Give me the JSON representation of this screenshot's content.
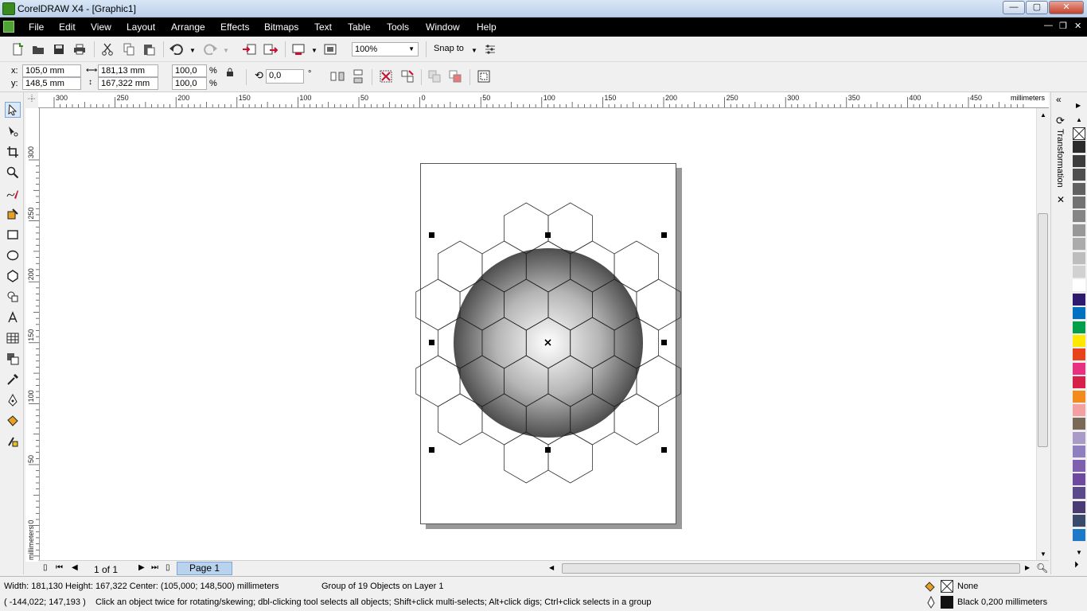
{
  "window": {
    "title": "CorelDRAW X4 - [Graphic1]",
    "controls": {
      "minimize": "—",
      "maximize": "▢",
      "close": "✕"
    }
  },
  "menu": {
    "items": [
      "File",
      "Edit",
      "View",
      "Layout",
      "Arrange",
      "Effects",
      "Bitmaps",
      "Text",
      "Table",
      "Tools",
      "Window",
      "Help"
    ],
    "doc_controls": {
      "minimize": "—",
      "restore": "❐",
      "close": "✕"
    }
  },
  "toolbar": {
    "zoom_value": "100%",
    "snap_to_label": "Snap to"
  },
  "property_bar": {
    "x_label": "x:",
    "x_value": "105,0 mm",
    "y_label": "y:",
    "y_value": "148,5 mm",
    "width_value": "181,13 mm",
    "height_value": "167,322 mm",
    "scale_x": "100,0",
    "scale_y": "100,0",
    "percent": "%",
    "rotation_value": "0,0",
    "degree": "°"
  },
  "ruler": {
    "h_labels": [
      "300",
      "250",
      "200",
      "150",
      "100",
      "50",
      "0",
      "50",
      "100",
      "150",
      "200",
      "250",
      "300",
      "350",
      "400",
      "450"
    ],
    "units": "millimeters",
    "v_labels": [
      "300",
      "250",
      "200",
      "150",
      "100",
      "50",
      "0"
    ],
    "v_units": "millimeters"
  },
  "docker": {
    "label": "Transformation"
  },
  "page_nav": {
    "page_count": "1 of 1",
    "page_tab": "Page 1"
  },
  "status": {
    "dimensions": "Width: 181,130  Height: 167,322  Center: (105,000; 148,500)  millimeters",
    "selection_info": "Group of 19 Objects on Layer 1",
    "cursor_position": "( -144,022; 147,193 )",
    "hint": "Click an object twice for rotating/skewing; dbl-clicking tool selects all objects; Shift+click multi-selects; Alt+click digs; Ctrl+click selects in a group",
    "fill_label": "None",
    "outline_label": "Black  0,200 millimeters"
  },
  "palette_colors": [
    "#ffffff",
    "#2b2b2b",
    "#3c3c3c",
    "#4f4f4f",
    "#616161",
    "#727272",
    "#858585",
    "#989898",
    "#ababab",
    "#bdbdbd",
    "#d1d1d1",
    "#ffffff",
    "#2e1a6e",
    "#0070c0",
    "#00a04a",
    "#ffe800",
    "#e8421a",
    "#e8317e",
    "#d6204a",
    "#f28a1c",
    "#f4a0a0",
    "#7a6a55",
    "#a99ac8",
    "#8e7fc0",
    "#7e5fb0",
    "#6d4a9e",
    "#5b4a8a",
    "#4a3c72",
    "#3b4a6a",
    "#1e78c8"
  ]
}
